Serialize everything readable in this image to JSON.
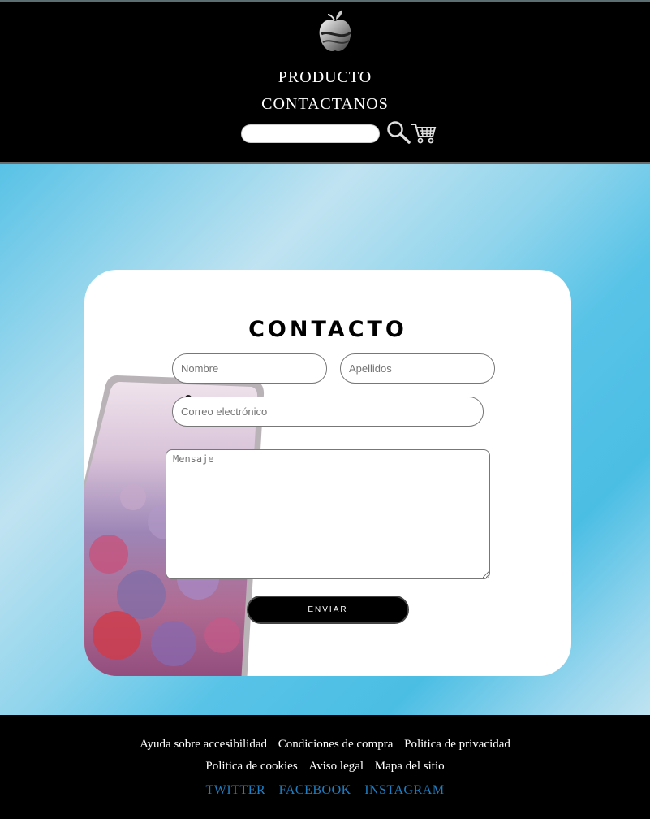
{
  "header": {
    "nav": [
      "PRODUCTO",
      "CONTACTANOS"
    ],
    "search_placeholder": "",
    "icons": [
      "apple-logo",
      "search-icon",
      "cart-icon"
    ]
  },
  "form": {
    "title": "CONTACTO",
    "nombre_placeholder": "Nombre",
    "apellidos_placeholder": "Apellidos",
    "correo_placeholder": "Correo electrónico",
    "mensaje_placeholder": "Mensaje",
    "submit_label": "ENVIAR"
  },
  "footer": {
    "links": [
      "Ayuda sobre accesibilidad",
      "Condiciones de compra",
      "Politica de privacidad",
      "Politica de cookies",
      "Aviso legal",
      "Mapa del sitio"
    ],
    "social": [
      "TWITTER",
      "FACEBOOK",
      "INSTAGRAM"
    ]
  },
  "colors": {
    "header_bg": "#000000",
    "accent_blue": "#4bbee4",
    "social_link": "#1e7fc4"
  }
}
